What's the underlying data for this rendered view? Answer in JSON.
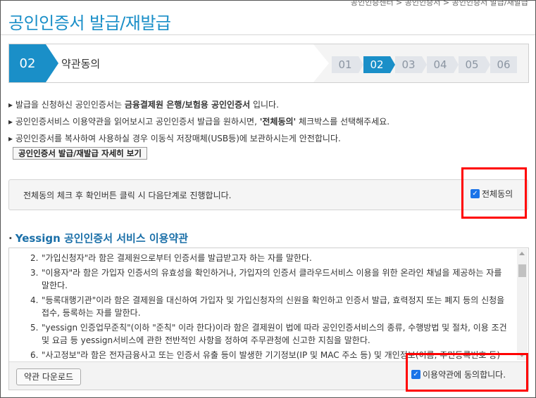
{
  "breadcrumb": "공인인증센터 > 공인인증서 > 공인인증서 발급/재발급",
  "page_title": "공인인증서 발급/재발급",
  "steps": {
    "current_number": "02",
    "current_label": "약관동의",
    "chips": [
      "01",
      "02",
      "03",
      "04",
      "05",
      "06"
    ],
    "active_index": 1
  },
  "notes": [
    {
      "pre": "발급을 신청하신 공인인증서는 ",
      "bold": "금융결제원 은행/보험용 공인인증서",
      "post": " 입니다."
    },
    {
      "pre": "공인인증서비스 이용약관을 읽어보시고 공인인증서 발급을 원하시면, ",
      "bold": "'전체동의'",
      "post": " 체크박스를 선택해주세요."
    },
    {
      "pre": "공인인증서를 복사하여 사용하실 경우 이동식 저장매체(USB등)에 보관하시는게 안전합니다.",
      "bold": "",
      "post": ""
    }
  ],
  "detail_button": "공인인증서 발급/재발급 자세히 보기",
  "agree_all": {
    "instruction": "전체동의 체크 후 확인버튼 클릭 시 다음단계로 진행합니다.",
    "checkbox_label": "전체동의",
    "checked": true
  },
  "terms_section": {
    "title": "Yessign 공인인증서 서비스 이용약관",
    "items": [
      {
        "n": "2.",
        "text": "\"가입신청자\"라 함은 결제원으로부터 인증서를 발급받고자 하는 자를 말한다."
      },
      {
        "n": "3.",
        "text": "\"이용자\"라 함은 가입자 인증서의 유효성을 확인하거나, 가입자의 인증서 클라우드서비스 이용을 위한 온라인 채널을 제공하는 자를 말한다."
      },
      {
        "n": "4.",
        "text": "\"등록대행기관\"이라 함은 결제원을 대신하여 가입자 및 가입신청자의 신원을 확인하고 인증서 발급, 효력정지 또는 폐지 등의 신청을 접수, 등록하는 자를 말한다."
      },
      {
        "n": "5.",
        "text": "\"yessign 인증업무준칙\"(이하 \"준칙\" 이라 한다)이라 함은 결제원이 법에 따라 공인인증서비스의 종류, 수행방법 및 절차, 이용 조건 및 요금 등 yessign서비스에 관한 전반적인 사항을 정하여 주무관청에 신고한 지침을 말한다."
      },
      {
        "n": "6.",
        "text": "\"사고정보\"라 함은 전자금융사고 또는 인증서 유출 등이 발생한 기기정보(IP 및 MAC 주소 등) 및 개인정보(이름, 주민등록번호 등)를 말한다."
      }
    ],
    "download_button": "약관 다운로드",
    "agree_label": "이용약관에 동의합니다.",
    "agree_checked": true
  },
  "colors": {
    "accent": "#1a8fc8",
    "highlight": "#ff0000",
    "checkbox": "#1a73e8"
  }
}
